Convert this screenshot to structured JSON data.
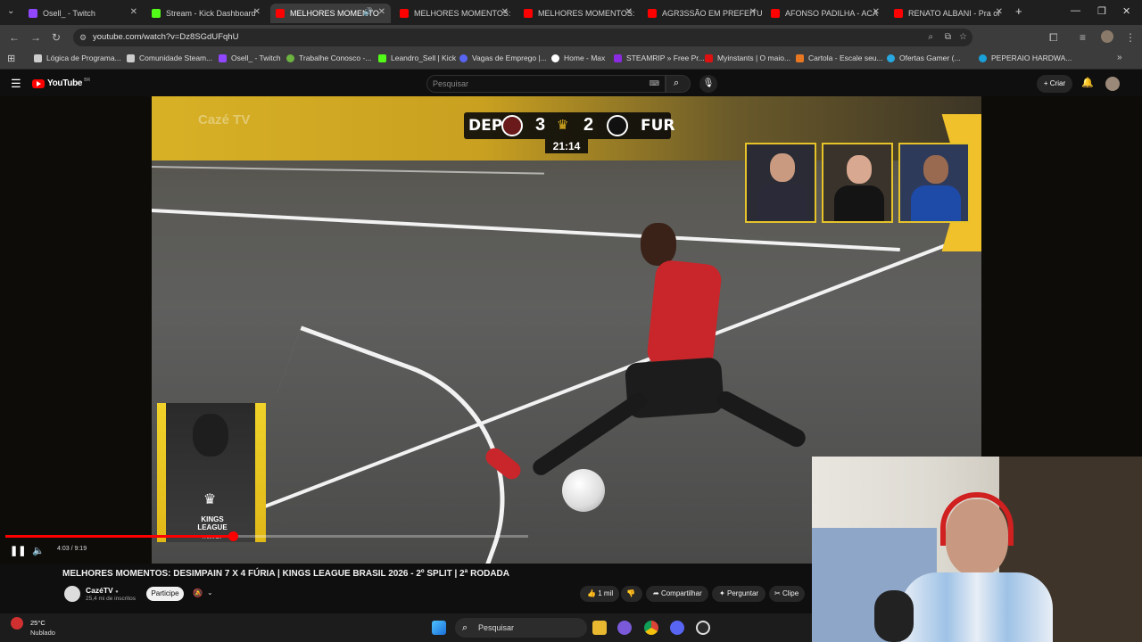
{
  "browser": {
    "tabs": [
      {
        "label": "Osell_ - Twitch",
        "color": "#9146ff"
      },
      {
        "label": "Stream - Kick Dashboard",
        "color": "#53fc18"
      },
      {
        "label": "MELHORES MOMENTO",
        "color": "#ff0000"
      },
      {
        "label": "MELHORES MOMENTOS:",
        "color": "#ff0000"
      },
      {
        "label": "MELHORES MOMENTOS:",
        "color": "#ff0000"
      },
      {
        "label": "AGR3SSÃO EM PREFEITU",
        "color": "#ff0000"
      },
      {
        "label": "AFONSO PADILHA - ACA",
        "color": "#ff0000"
      },
      {
        "label": "RENATO ALBANI - Pra or",
        "color": "#ff0000"
      }
    ],
    "active_tab": 2,
    "url": "youtube.com/watch?v=Dz8SGdUFqhU",
    "bookmarks": [
      {
        "label": "Lógica de Programa...",
        "color": "#cccccc"
      },
      {
        "label": "Comunidade Steam...",
        "color": "#cccccc"
      },
      {
        "label": "Osell_ - Twitch",
        "color": "#9146ff"
      },
      {
        "label": "Trabalhe Conosco -...",
        "color": "#6db33f"
      },
      {
        "label": "Leandro_Sell | Kick",
        "color": "#53fc18"
      },
      {
        "label": "Vagas de Emprego |...",
        "color": "#5865f2"
      },
      {
        "label": "Home - Max",
        "color": "#ffffff"
      },
      {
        "label": "STEAMRIP » Free Pr...",
        "color": "#8a2be2"
      },
      {
        "label": "Myinstants | O maio...",
        "color": "#d11"
      },
      {
        "label": "Cartola - Escale seu...",
        "color": "#e87722"
      },
      {
        "label": "Ofertas Gamer (...",
        "color": "#28a8e0"
      },
      {
        "label": "PEPERAIO HARDWA...",
        "color": "#19a0d8"
      }
    ]
  },
  "youtube": {
    "logo": "YouTube",
    "logo_region": "BR",
    "search_placeholder": "Pesquisar",
    "create_label": "Criar",
    "video_title": "MELHORES MOMENTOS: DESIMPAIN 7 X 4 FÚRIA | KINGS LEAGUE BRASIL 2026 - 2º SPLIT | 2ª RODADA",
    "channel": "CazéTV",
    "subscribers": "25,4 mi de inscritos",
    "join_label": "Participe",
    "likes": "1 mil",
    "share_label": "Compartilhar",
    "ask_label": "Perguntar",
    "clip_label": "Clipe",
    "time_current": "4:03",
    "time_total": "9:19",
    "progress": 0.435
  },
  "scoreboard": {
    "home": "DEP",
    "home_score": "3",
    "away": "FUR",
    "away_score": "2",
    "clock": "21:14"
  },
  "overlay_text": {
    "league_card": "KINGS LEAGUE",
    "league_card_sub": "FANTASY",
    "watermark": "Cazé TV"
  },
  "taskbar": {
    "temperature": "25°C",
    "weather": "Nublado",
    "search_label": "Pesquisar"
  }
}
